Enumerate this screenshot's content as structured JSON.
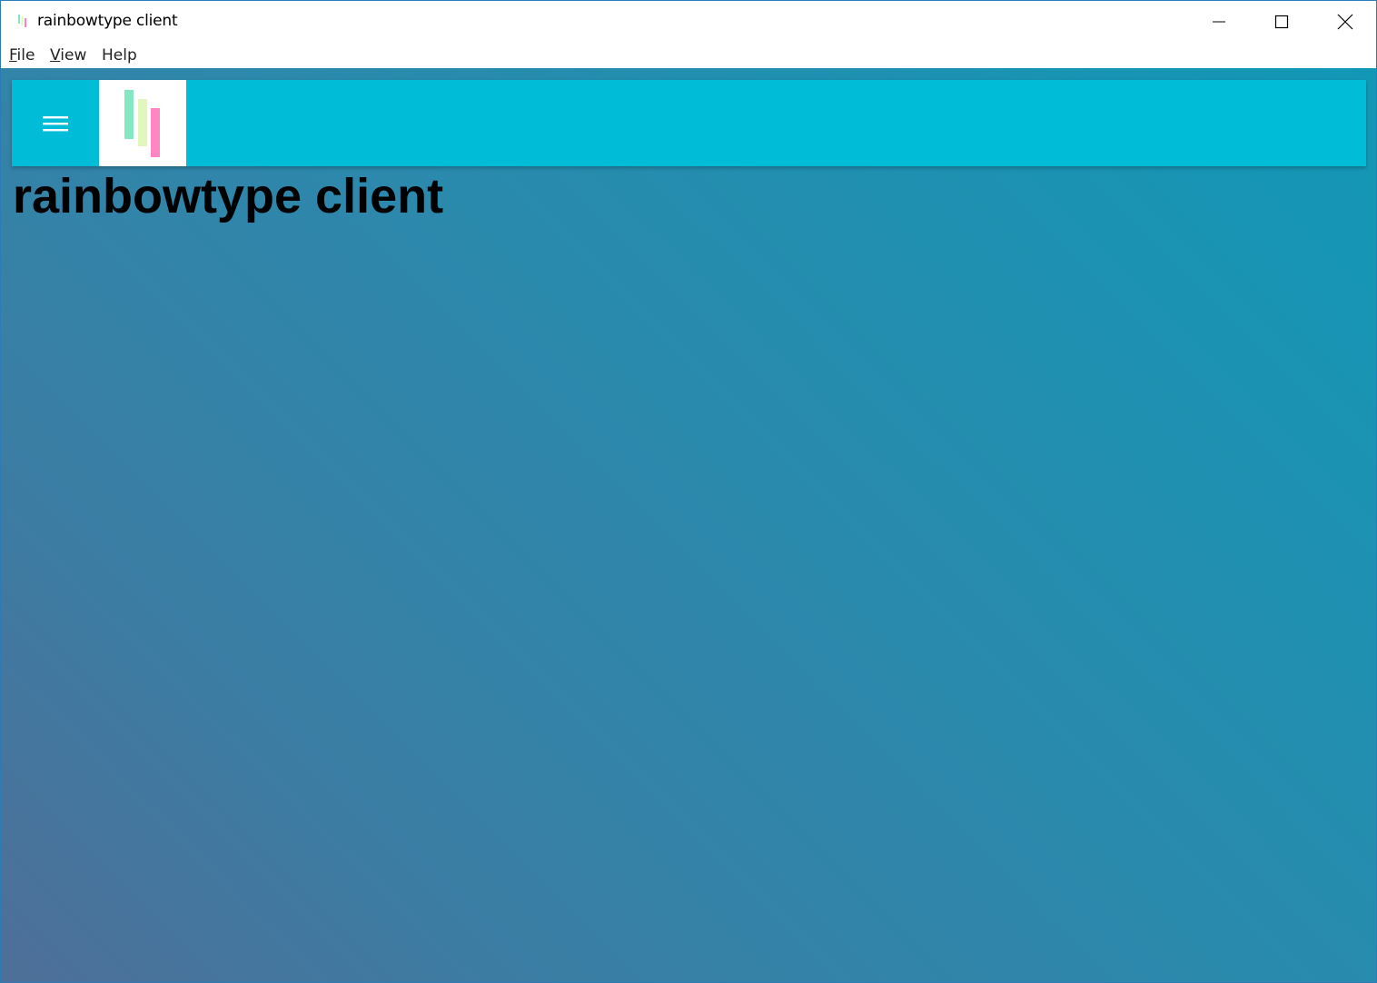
{
  "window": {
    "title": "rainbowtype client",
    "controls": {
      "minimize": "minimize-icon",
      "maximize": "maximize-icon",
      "close": "close-icon"
    }
  },
  "menubar": {
    "items": [
      {
        "label": "File",
        "accel": "F"
      },
      {
        "label": "View",
        "accel": "V"
      },
      {
        "label": "Help",
        "accel": ""
      }
    ]
  },
  "appbar": {
    "menu_icon": "hamburger-menu-icon",
    "logo_icon": "rainbowtype-logo-icon",
    "color": "#00bcd6"
  },
  "main": {
    "heading": "rainbowtype client"
  },
  "colors": {
    "gradient_top_right": "#1298b6",
    "gradient_bottom_left": "#4e6f98",
    "logo_green": "#7de8c0",
    "logo_yellow": "#dff7b8",
    "logo_pink": "#ff7fbf"
  }
}
